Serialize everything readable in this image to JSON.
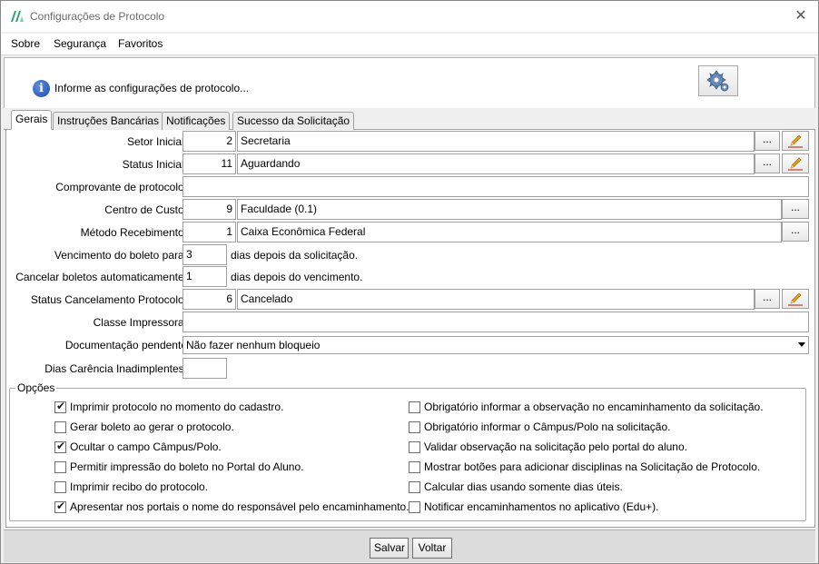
{
  "window": {
    "title": "Configurações de Protocolo"
  },
  "menu": [
    "Sobre",
    "Segurança",
    "Favoritos"
  ],
  "info": {
    "text": "Informe as configurações de protocolo..."
  },
  "tabs": [
    "Gerais",
    "Instruções Bancárias",
    "Notificações",
    "Sucesso da Solicitação"
  ],
  "fields": {
    "setor_inicial": {
      "label": "Setor Inicial:",
      "code": "2",
      "value": "Secretaria"
    },
    "status_inicial": {
      "label": "Status Inicial:",
      "code": "11",
      "value": "Aguardando"
    },
    "comprovante": {
      "label": "Comprovante de protocolo:",
      "value": ""
    },
    "centro_custo": {
      "label": "Centro de Custo:",
      "code": "9",
      "value": "Faculdade (0.1)"
    },
    "metodo_recebimento": {
      "label": "Método Recebimento:",
      "code": "1",
      "value": "Caixa Econômica Federal"
    },
    "vencimento": {
      "label": "Vencimento do boleto para:",
      "value": "3",
      "suffix": "dias depois da solicitação."
    },
    "cancelar": {
      "label": "Cancelar boletos automaticamente:",
      "value": "1",
      "suffix": "dias depois do vencimento."
    },
    "status_cancelamento": {
      "label": "Status Cancelamento Protocolo:",
      "code": "6",
      "value": "Cancelado"
    },
    "classe_impressora": {
      "label": "Classe Impressora:",
      "value": ""
    },
    "documentacao": {
      "label": "Documentação pendente",
      "selected": "Não fazer nenhum bloqueio"
    },
    "dias_carencia": {
      "label": "Dias Carência Inadimplentes:",
      "value": ""
    }
  },
  "lookup_label": "...",
  "options": {
    "legend": "Opções",
    "left": [
      {
        "label": "Imprimir protocolo no momento do cadastro.",
        "checked": true
      },
      {
        "label": "Gerar boleto ao gerar o protocolo.",
        "checked": false
      },
      {
        "label": "Ocultar o campo Câmpus/Polo.",
        "checked": true
      },
      {
        "label": "Permitir impressão do boleto no Portal do Aluno.",
        "checked": false
      },
      {
        "label": "Imprimir recibo do protocolo.",
        "checked": false
      },
      {
        "label": "Apresentar nos portais o nome do responsável pelo encaminhamento.",
        "checked": true
      }
    ],
    "right": [
      {
        "label": "Obrigatório informar a observação no encaminhamento da solicitação.",
        "checked": false
      },
      {
        "label": "Obrigatório informar o Câmpus/Polo na solicitação.",
        "checked": false
      },
      {
        "label": "Validar observação na solicitação pelo portal do aluno.",
        "checked": false
      },
      {
        "label": "Mostrar botões para adicionar disciplinas na Solicitação de Protocolo.",
        "checked": false
      },
      {
        "label": "Calcular dias usando somente dias úteis.",
        "checked": false
      },
      {
        "label": "Notificar encaminhamentos no aplicativo (Edu+).",
        "checked": false
      }
    ]
  },
  "buttons": {
    "save": "Salvar",
    "back": "Voltar"
  },
  "icons": {
    "app": "app-logo-icon",
    "close": "close-icon",
    "info": "info-icon",
    "gear": "gears-icon",
    "edit": "pencil-icon",
    "dropdown": "chevron-down-icon",
    "check": "checkmark-icon"
  },
  "colors": {
    "accent": "#1d4fb0",
    "pencil": "#e8a317"
  }
}
